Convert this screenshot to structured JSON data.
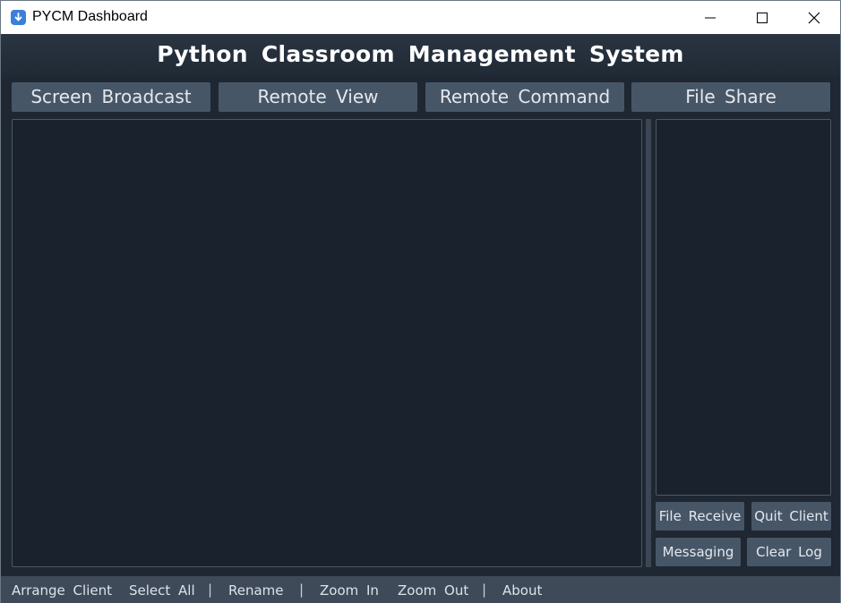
{
  "window": {
    "title": "PYCM Dashboard"
  },
  "header": {
    "title": "Python Classroom Management System"
  },
  "tabs": [
    {
      "label": "Screen Broadcast"
    },
    {
      "label": "Remote View"
    },
    {
      "label": "Remote Command"
    },
    {
      "label": "File Share"
    }
  ],
  "side_buttons": {
    "file_receive": "File Receive",
    "quit_client": "Quit Client",
    "messaging": "Messaging",
    "clear_log": "Clear Log"
  },
  "bottom_menu": {
    "arrange_client": "Arrange Client",
    "select_all": "Select All",
    "rename": "Rename",
    "zoom_in": "Zoom In",
    "zoom_out": "Zoom Out",
    "about": "About",
    "separator": "|"
  },
  "colors": {
    "background": "#1e2732",
    "button": "#475667",
    "panel": "#1a232d",
    "status_bar": "#3f4a59"
  }
}
